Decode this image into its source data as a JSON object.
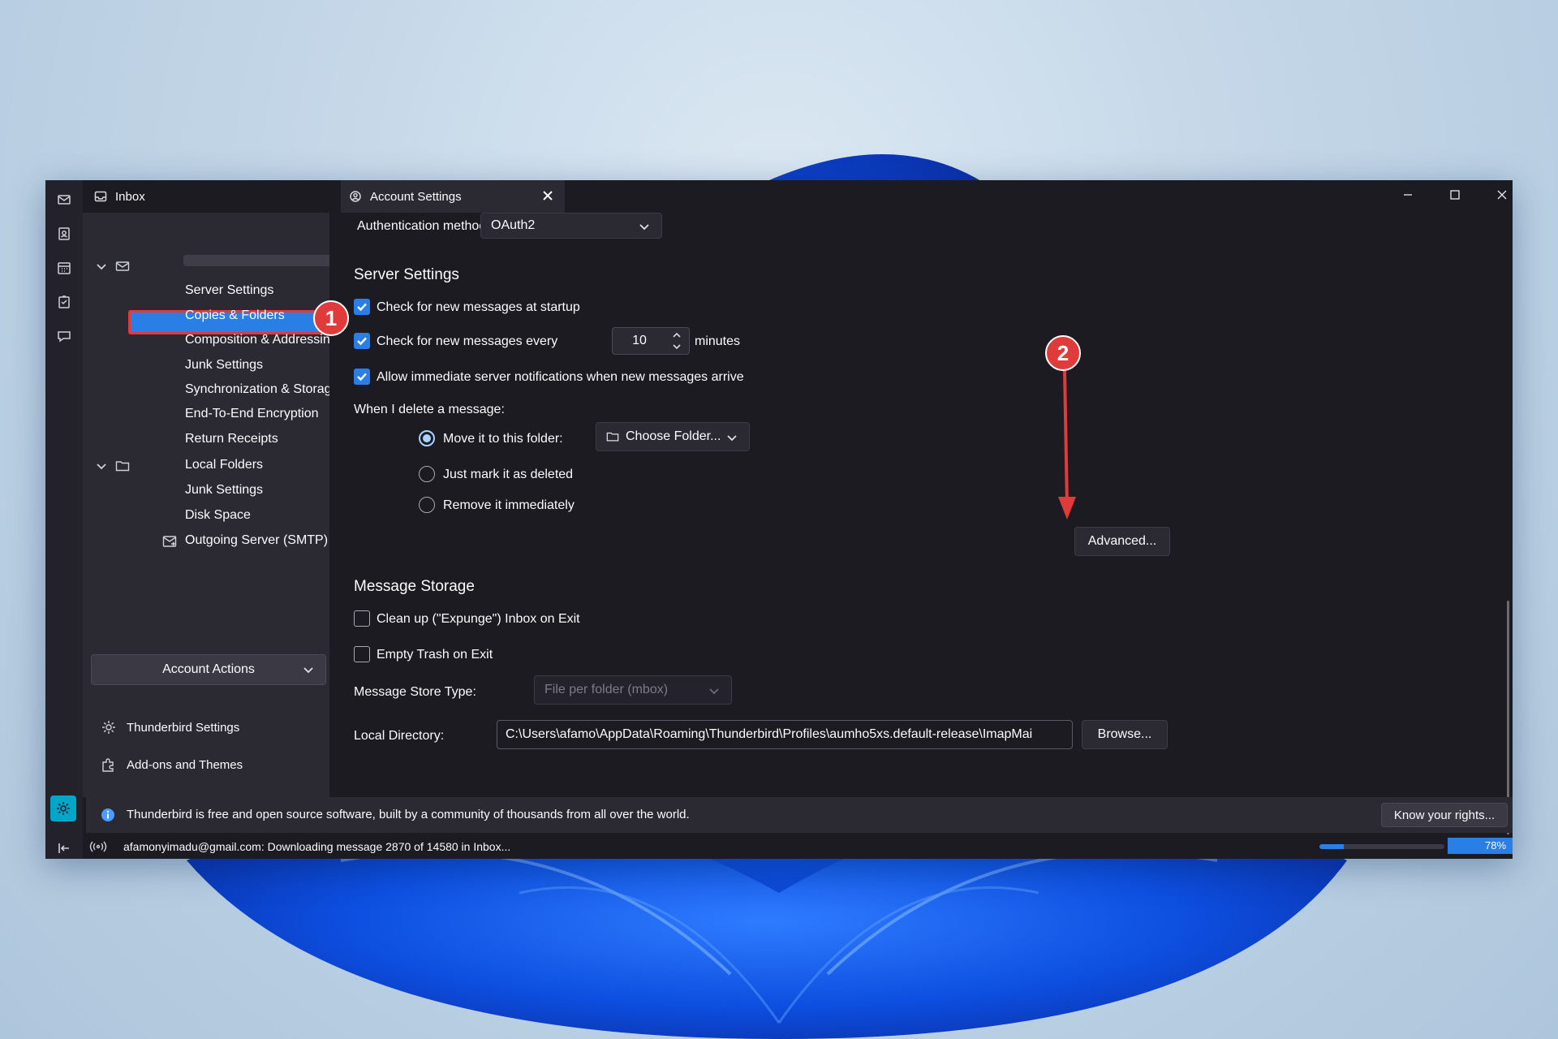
{
  "tabs": {
    "inbox": "Inbox",
    "account_settings": "Account Settings"
  },
  "sidebar": {
    "account_items": [
      "Server Settings",
      "Copies & Folders",
      "Composition & Addressing",
      "Junk Settings",
      "Synchronization & Storage",
      "End-To-End Encryption",
      "Return Receipts"
    ],
    "local_folders": "Local Folders",
    "local_items": [
      "Junk Settings",
      "Disk Space"
    ],
    "outgoing_server": "Outgoing Server (SMTP)",
    "account_actions": "Account Actions",
    "thunderbird_settings": "Thunderbird Settings",
    "addons": "Add-ons and Themes"
  },
  "main": {
    "auth_label": "Authentication method:",
    "auth_value": "OAuth2",
    "server_settings_heading": "Server Settings",
    "check_startup": "Check for new messages at startup",
    "check_every": "Check for new messages every",
    "check_every_value": "10",
    "minutes": "minutes",
    "allow_notifications": "Allow immediate server notifications when new messages arrive",
    "delete_label": "When I delete a message:",
    "move_to_folder": "Move it to this folder:",
    "choose_folder": "Choose Folder...",
    "mark_deleted": "Just mark it as deleted",
    "remove_immediately": "Remove it immediately",
    "advanced": "Advanced...",
    "message_storage_heading": "Message Storage",
    "clean_up": "Clean up (\"Expunge\") Inbox on Exit",
    "empty_trash": "Empty Trash on Exit",
    "store_type_label": "Message Store Type:",
    "store_type_value": "File per folder (mbox)",
    "local_dir_label": "Local Directory:",
    "local_dir_value": "C:\\Users\\afamo\\AppData\\Roaming\\Thunderbird\\Profiles\\aumho5xs.default-release\\ImapMai",
    "browse": "Browse..."
  },
  "notification": {
    "message": "Thunderbird is free and open source software, built by a community of thousands from all over the world.",
    "know_rights": "Know your rights..."
  },
  "status": {
    "text": "afamonyimadu@gmail.com: Downloading message 2870 of 14580 in Inbox...",
    "download_progress": 0.197,
    "percent_label": "78%",
    "percent_value": 0.78
  },
  "annotations": {
    "badge1": "1",
    "badge2": "2"
  },
  "colors": {
    "accent": "#2a7fe6",
    "annotation_red": "#e13a3a",
    "window_bg": "#1c1b22",
    "panel_bg": "#2b2a33"
  }
}
